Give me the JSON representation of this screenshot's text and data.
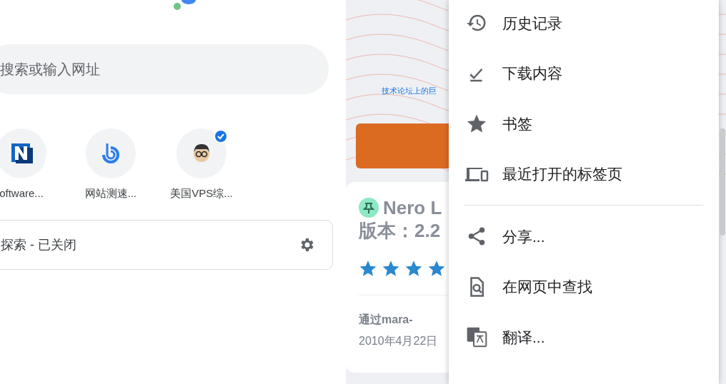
{
  "new_tab": {
    "search": {
      "placeholder": "搜索或输入网址"
    },
    "shortcuts": [
      {
        "label": "oftware...",
        "badge": false
      },
      {
        "label": "网站测速...",
        "badge": false
      },
      {
        "label": "美国VPS综...",
        "badge": true
      }
    ],
    "discover": {
      "label": "探索 - 已关闭"
    }
  },
  "web_page": {
    "tagline": "技术论坛上的巨",
    "card": {
      "title_lines": [
        "Nero L",
        "版本：2.2"
      ],
      "stars": 4,
      "author": "通过mara-",
      "date": "2010年4月22日"
    }
  },
  "menu": {
    "items": [
      {
        "kind": "item",
        "label": "历史记录"
      },
      {
        "kind": "item",
        "label": "下载内容"
      },
      {
        "kind": "item",
        "label": "书签"
      },
      {
        "kind": "item",
        "label": "最近打开的标签页"
      },
      {
        "kind": "divider"
      },
      {
        "kind": "item",
        "label": "分享..."
      },
      {
        "kind": "item",
        "label": "在网页中查找"
      },
      {
        "kind": "item",
        "label": "翻译..."
      }
    ]
  }
}
